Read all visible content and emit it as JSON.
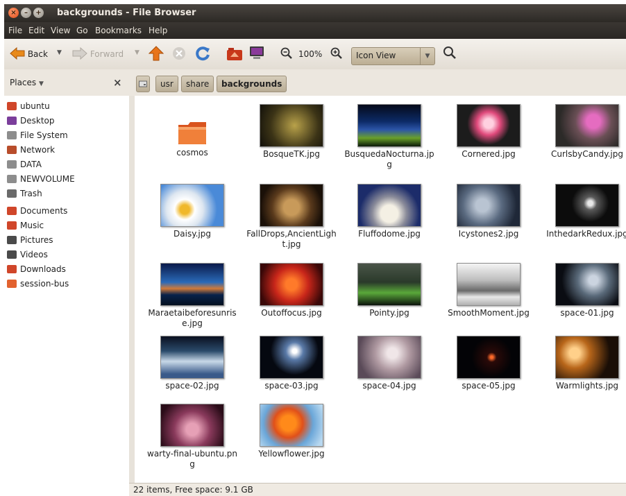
{
  "window": {
    "title": "backgrounds - File Browser"
  },
  "menubar": [
    "File",
    "Edit",
    "View",
    "Go",
    "Bookmarks",
    "Help"
  ],
  "toolbar": {
    "back_label": "Back",
    "forward_label": "Forward",
    "zoom_level": "100%",
    "view_mode": "Icon View",
    "icons": [
      "back-arrow-icon",
      "forward-arrow-icon",
      "up-arrow-icon",
      "stop-icon",
      "reload-icon",
      "home-icon",
      "computer-icon",
      "zoom-out-icon",
      "zoom-in-icon",
      "search-icon"
    ]
  },
  "places": {
    "header": "Places",
    "close_icon": "×",
    "items": [
      {
        "label": "ubuntu",
        "color": "#d0462a"
      },
      {
        "label": "Desktop",
        "color": "#7b3e9b"
      },
      {
        "label": "File System",
        "color": "#8d8d8d"
      },
      {
        "label": "Network",
        "color": "#b84d2b"
      },
      {
        "label": "DATA",
        "color": "#8d8d8d"
      },
      {
        "label": "NEWVOLUME",
        "color": "#8d8d8d"
      },
      {
        "label": "Trash",
        "color": "#6a6a6a"
      },
      {
        "label": "Documents",
        "color": "#d0462a"
      },
      {
        "label": "Music",
        "color": "#d0462a"
      },
      {
        "label": "Pictures",
        "color": "#4a4a4a"
      },
      {
        "label": "Videos",
        "color": "#4a4a4a"
      },
      {
        "label": "Downloads",
        "color": "#d0462a"
      },
      {
        "label": "session-bus",
        "color": "#e2622f"
      }
    ]
  },
  "breadcrumb": [
    "usr",
    "share",
    "backgrounds"
  ],
  "files": [
    {
      "name": "cosmos",
      "type": "folder"
    },
    {
      "name": "BosqueTK.jpg",
      "bg": "radial-gradient(circle at 55% 50%, #b9a24a, #3b3316 60%, #12100a)"
    },
    {
      "name": "BusquedaNocturna.jpg",
      "bg": "linear-gradient(#050a1a 0%, #0c2a66 40%, #2c55a8 60%, #6aa02a 80%, #0b1a08)"
    },
    {
      "name": "Cornered.jpg",
      "bg": "radial-gradient(circle at 50% 45%, #ffd0e0 12%, #e04a7c 30%, #1c1c1c 55%)"
    },
    {
      "name": "CurlsbyCandy.jpg",
      "bg": "radial-gradient(circle at 60% 40%, #e56cc0 15%, #6a4f55 40%, #2c2a28 75%)"
    },
    {
      "name": "Daisy.jpg",
      "bg": "radial-gradient(circle at 38% 60%, #f0b82a 10%, #ffffff 22%, #dde6f0 40%, #4a8ad8 70%)"
    },
    {
      "name": "FallDrops,AncientLight.jpg",
      "bg": "radial-gradient(circle at 50% 55%, #c89a5a 20%, #5a3a1c 50%, #1a1008 80%)"
    },
    {
      "name": "Fluffodome.jpg",
      "bg": "radial-gradient(circle at 50% 70%, #f4f0e4 20%, #8b8c9a 40%, #1c2c6a 70%)"
    },
    {
      "name": "Icystones2.jpg",
      "bg": "radial-gradient(circle at 40% 50%, #b9c4d2 15%, #5a6a80 45%, #1f2838 80%)"
    },
    {
      "name": "InthedarkRedux.jpg",
      "bg": "radial-gradient(circle at 55% 45%, #e8e8e8 6%, #5a5a5a 16%, #0c0c0c 45%)"
    },
    {
      "name": "Maraetaibeforesunrise.jpg",
      "bg": "linear-gradient(#0a1a4a 0%, #2a6ab8 45%, #d07a3a 60%, #08224a 75%, #041020)"
    },
    {
      "name": "Outoffocus.jpg",
      "bg": "radial-gradient(circle at 50% 50%, #ff7a2a 15%, #c8261a 45%, #3a0808 85%)"
    },
    {
      "name": "Pointy.jpg",
      "bg": "linear-gradient(#4a5448 0%, #2a3a2a 45%, #5aa83a 70%, #0c140c)"
    },
    {
      "name": "SmoothMoment.jpg",
      "bg": "linear-gradient(#f4f4f4 0%, #bdbdbd 40%, #6a6a6a 65%, #e8e8e8 80%, #b0b0b0)"
    },
    {
      "name": "space-01.jpg",
      "bg": "radial-gradient(circle at 60% 40%, #cbd4e0 10%, #5a6a7a 35%, #0a0c12 70%)"
    },
    {
      "name": "space-02.jpg",
      "bg": "linear-gradient(#0a1020 0%, #2a4a6a 35%, #c8d8e8 60%, #3a5a8a 90%)"
    },
    {
      "name": "space-03.jpg",
      "bg": "radial-gradient(circle at 55% 35%, #ffffff 5%, #5a7aa8 20%, #050810 55%)"
    },
    {
      "name": "space-04.jpg",
      "bg": "radial-gradient(circle at 55% 40%, #f0e6e8 12%, #b09aa2 40%, #5a4a58 80%)"
    },
    {
      "name": "space-05.jpg",
      "bg": "radial-gradient(circle at 55% 50%, #ff6a2a 3%, #2a0a08 12%, #030306 50%)"
    },
    {
      "name": "Warmlights.jpg",
      "bg": "radial-gradient(circle at 30% 40%, #ffd08a 10%, #b8661a 30%, #1a0e06 70%)"
    },
    {
      "name": "warty-final-ubuntu.png",
      "bg": "radial-gradient(circle at 50% 60%, #e6a0b6 15%, #8a3a5c 45%, #2a0c18 85%)"
    },
    {
      "name": "Yellowflower.jpg",
      "bg": "radial-gradient(circle at 45% 45%, #ff8a1a 18%, #e0501a 35%, #6aa6d8 60%, #b8d8f0 90%)"
    }
  ],
  "statusbar": {
    "text": "22 items, Free space: 9.1 GB"
  }
}
